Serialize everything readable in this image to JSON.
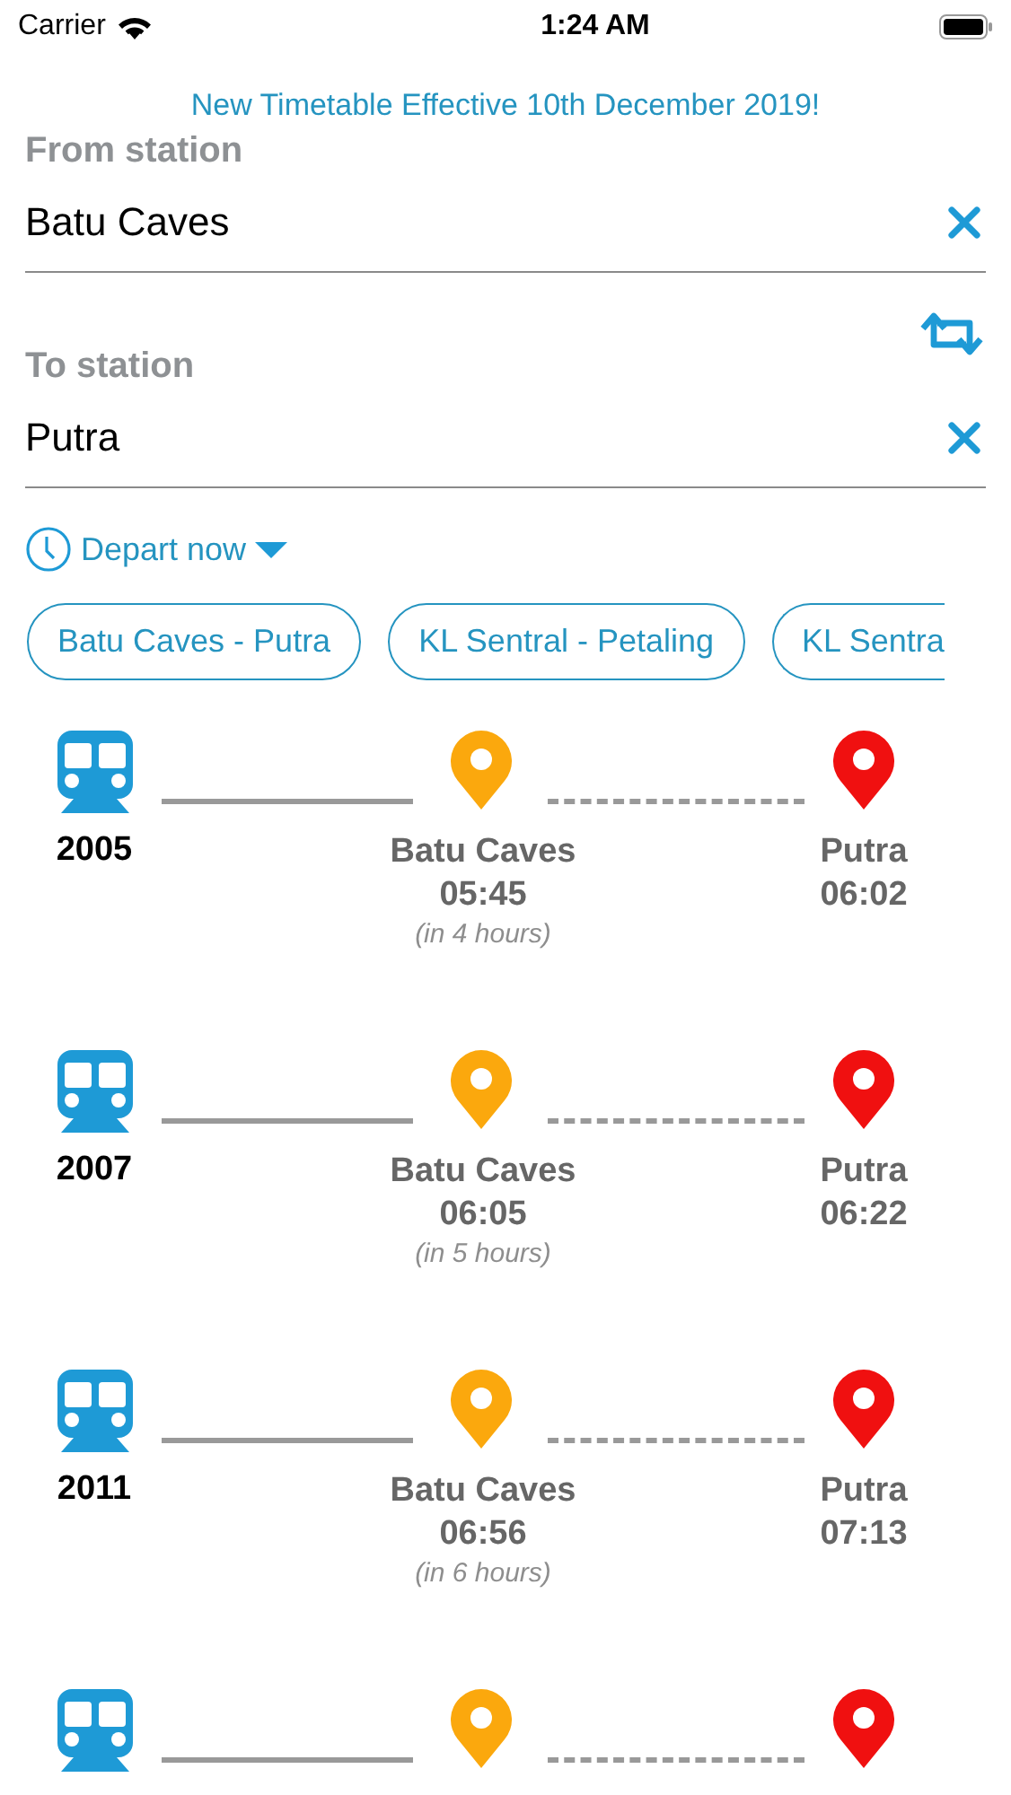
{
  "status_bar": {
    "carrier": "Carrier",
    "time": "1:24 AM"
  },
  "notice": "New Timetable Effective 10th December 2019!",
  "from": {
    "label": "From station",
    "value": "Batu Caves"
  },
  "to": {
    "label": "To station",
    "value": "Putra"
  },
  "depart": {
    "label": "Depart now"
  },
  "routes": [
    {
      "label": "Batu Caves - Putra"
    },
    {
      "label": "KL Sentral - Petaling"
    },
    {
      "label": "KL Sentra"
    }
  ],
  "trips": [
    {
      "kind": "full",
      "train": "2005",
      "origin": "Batu Caves",
      "depart": "05:45",
      "relative": "(in 4 hours)",
      "destination": "Putra",
      "arrive": "06:02"
    },
    {
      "kind": "full",
      "train": "2007",
      "origin": "Batu Caves",
      "depart": "06:05",
      "relative": "(in 5 hours)",
      "destination": "Putra",
      "arrive": "06:22"
    },
    {
      "kind": "full",
      "train": "2011",
      "origin": "Batu Caves",
      "depart": "06:56",
      "relative": "(in 6 hours)",
      "destination": "Putra",
      "arrive": "07:13"
    },
    {
      "kind": "cut"
    }
  ]
}
